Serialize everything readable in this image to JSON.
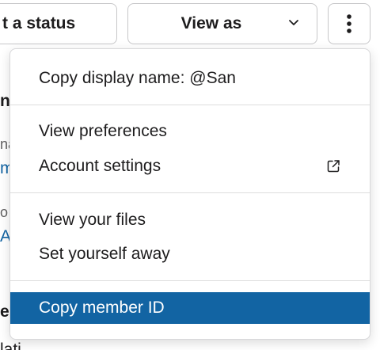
{
  "header": {
    "status_button_label": "t a status",
    "view_as_label": "View as",
    "more_button_icon": "vertical-ellipsis-icon"
  },
  "background": {
    "frag1": "n",
    "frag2": "na",
    "frag3": "m",
    "frag4": "o",
    "frag5": "A",
    "frag6": "e",
    "frag7": "lati"
  },
  "menu": {
    "copy_display_name": "Copy display name: @San",
    "view_preferences": "View preferences",
    "account_settings": "Account settings",
    "account_settings_icon": "external-link-icon",
    "view_your_files": "View your files",
    "set_yourself_away": "Set yourself away",
    "copy_member_id": "Copy member ID"
  },
  "colors": {
    "highlight": "#1264a3",
    "link": "#1264a3",
    "text": "#1d1c1d",
    "border": "#c7c7c9"
  }
}
